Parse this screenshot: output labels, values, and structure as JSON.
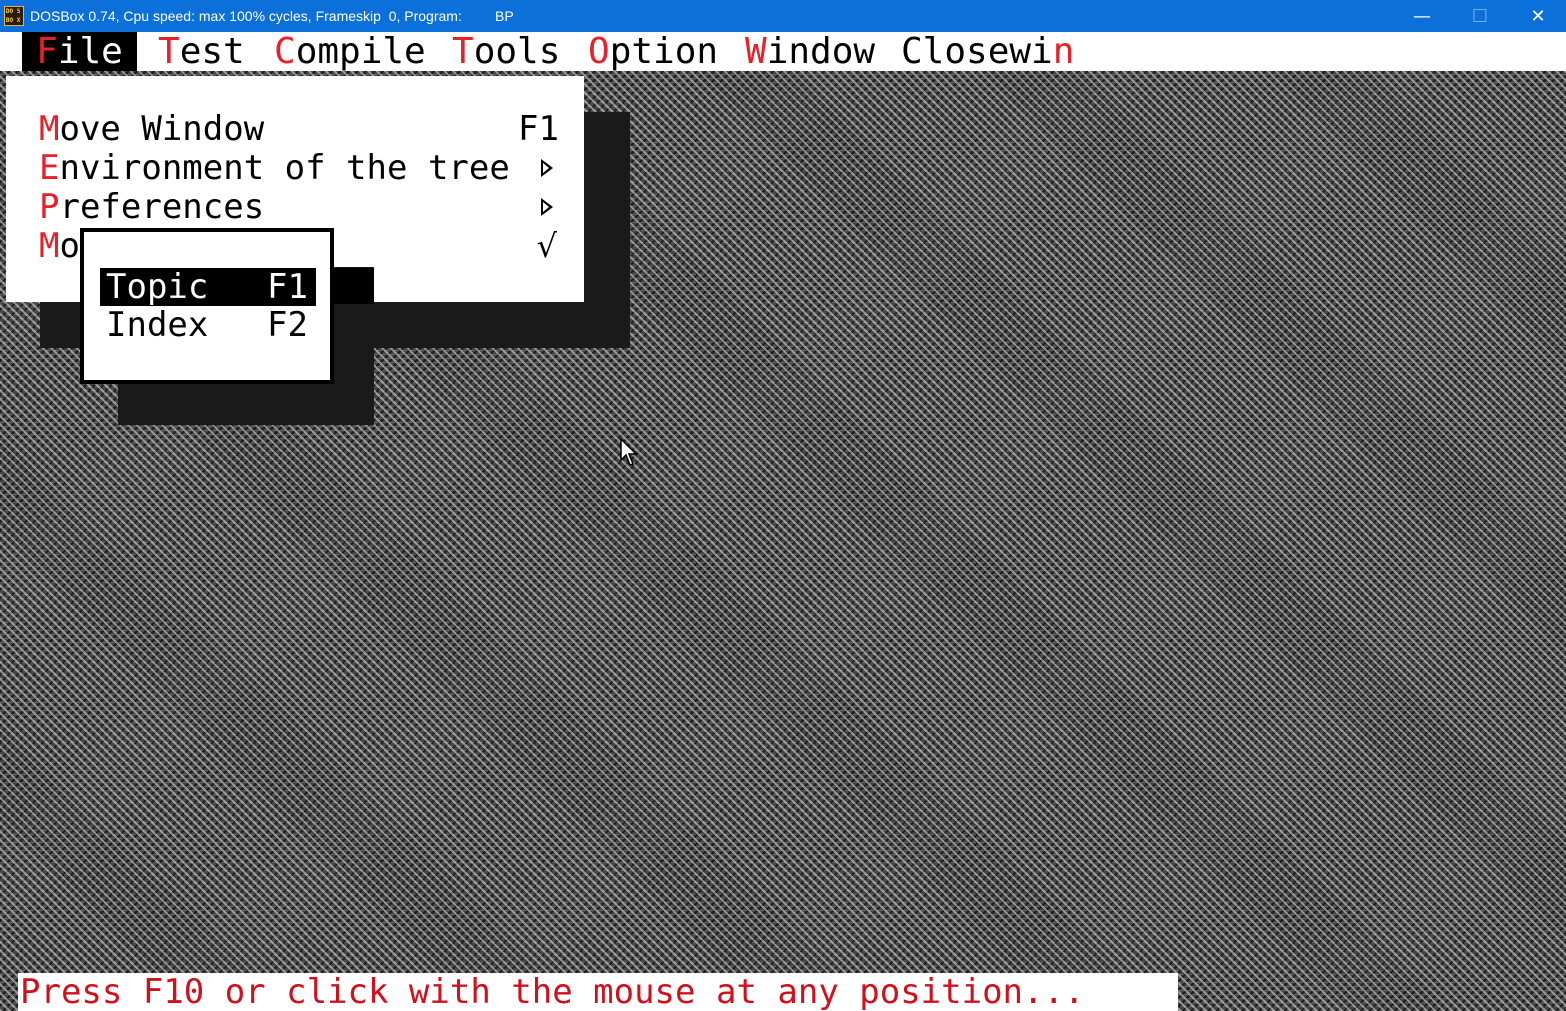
{
  "window": {
    "title": "DOSBox 0.74, Cpu speed: max 100% cycles, Frameskip  0, Program:",
    "program": "BP",
    "icon": "dosbox-icon",
    "controls": {
      "minimize": "—",
      "maximize": "☐",
      "close": "✕"
    }
  },
  "menubar": {
    "items": [
      {
        "hotkey": "F",
        "rest": "ile",
        "active": true
      },
      {
        "hotkey": "T",
        "rest": "est"
      },
      {
        "hotkey": "C",
        "rest": "ompile"
      },
      {
        "hotkey": "T",
        "rest": "ools"
      },
      {
        "hotkey": "O",
        "rest": "ption"
      },
      {
        "hotkey": "W",
        "rest": "indow"
      },
      {
        "prefix": "Closewi",
        "hotkey": "n"
      }
    ]
  },
  "file_menu": {
    "items": [
      {
        "hotkey": "M",
        "rest": "ove Window",
        "shortcut": "F1"
      },
      {
        "hotkey": "E",
        "rest": "nvironment of the tree",
        "submenu": true
      },
      {
        "hotkey": "P",
        "rest": "references",
        "submenu": true
      },
      {
        "hotkey": "M",
        "rest": "o",
        "checked": true,
        "check": "√"
      }
    ]
  },
  "help_menu": {
    "items": [
      {
        "label": "Topic",
        "shortcut": "F1",
        "selected": true
      },
      {
        "label": "Index",
        "shortcut": "F2"
      }
    ]
  },
  "status": {
    "text": "Press F10 or click with the mouse at any position..."
  },
  "colors": {
    "titlebar": "#0b70d9",
    "hotkey": "#e8202a",
    "status_text": "#d0101c",
    "menu_bg": "#ffffff",
    "selected_bg": "#000000"
  }
}
